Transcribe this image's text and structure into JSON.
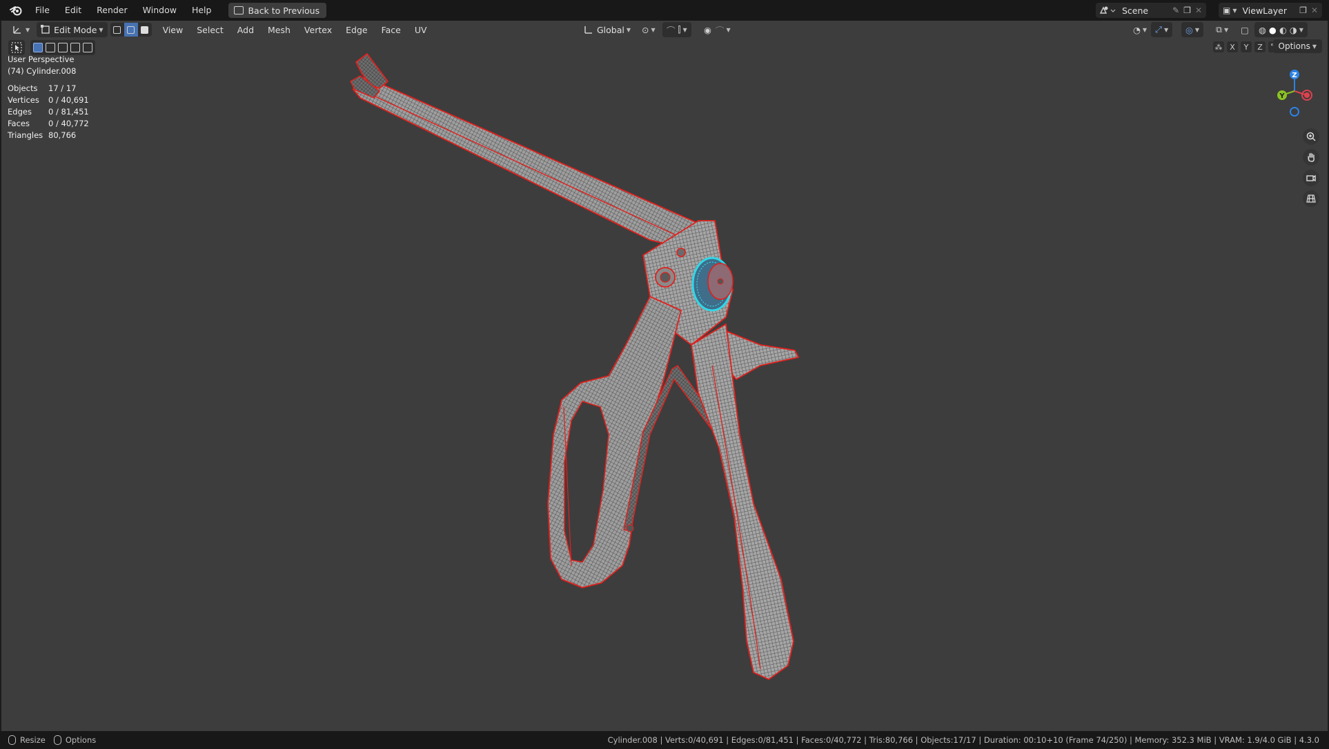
{
  "app": {
    "menus": [
      "File",
      "Edit",
      "Render",
      "Window",
      "Help"
    ],
    "back_button": "Back to Previous",
    "scene_label": "Scene",
    "view_layer_label": "ViewLayer"
  },
  "viewport_header": {
    "mode": "Edit Mode",
    "menus": [
      "View",
      "Select",
      "Add",
      "Mesh",
      "Vertex",
      "Edge",
      "Face",
      "UV"
    ],
    "orientation": "Global",
    "options_label": "Options",
    "axis_labels": [
      "X",
      "Y",
      "Z"
    ]
  },
  "overlay": {
    "perspective": "User Perspective",
    "object": "(74) Cylinder.008",
    "stats": [
      {
        "key": "Objects",
        "value": "17 / 17"
      },
      {
        "key": "Vertices",
        "value": "0 / 40,691"
      },
      {
        "key": "Edges",
        "value": "0 / 81,451"
      },
      {
        "key": "Faces",
        "value": "0 / 40,772"
      },
      {
        "key": "Triangles",
        "value": "80,766"
      }
    ]
  },
  "gizmo": {
    "z": "Z",
    "y": "Y",
    "x": "X"
  },
  "statusbar": {
    "left": [
      "Resize",
      "Options"
    ],
    "right": "Cylinder.008 | Verts:0/40,691 | Edges:0/81,451 | Faces:0/40,772 | Tris:80,766 | Objects:17/17 | Duration: 00:10+10 (Frame 74/250) | Memory: 352.3 MiB | VRAM: 1.9/4.0 GiB | 4.3.0"
  },
  "colors": {
    "viewport_bg": "#3d3d3d",
    "seam_red": "#e0211d",
    "selection_cyan": "#2fd8e8",
    "axis_x": "#e0414f",
    "axis_y": "#8bc323",
    "axis_z": "#2d82e6"
  }
}
